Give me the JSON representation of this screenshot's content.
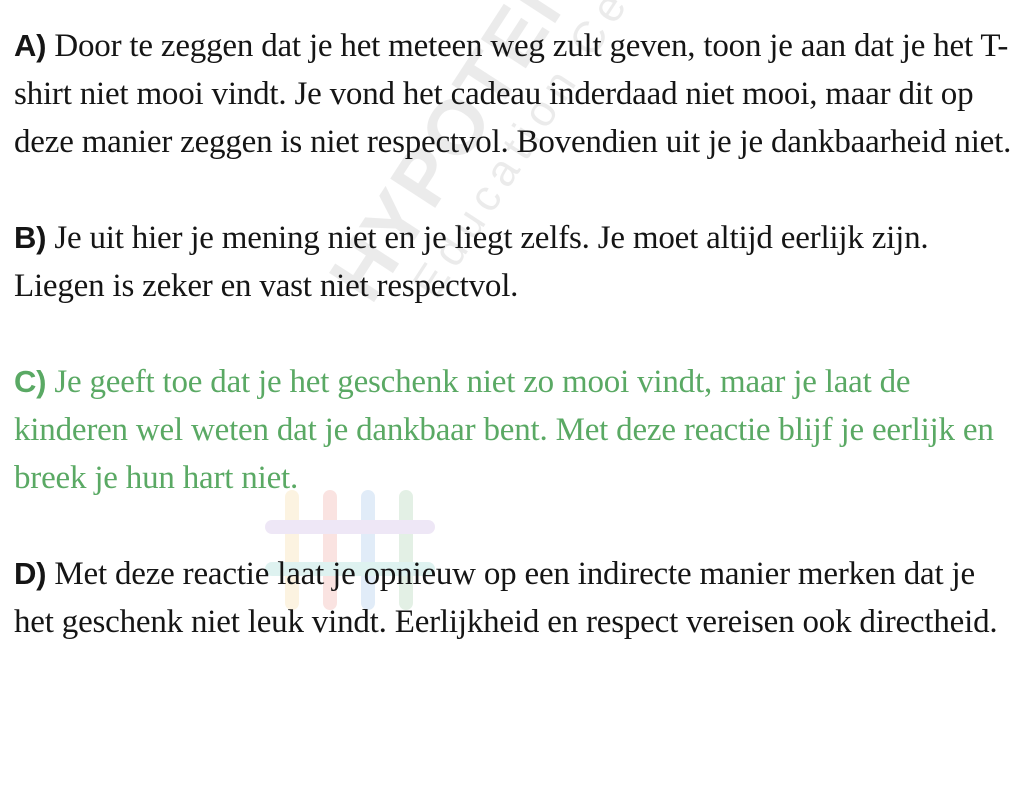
{
  "colors": {
    "text": "#151515",
    "correct": "#5aa964"
  },
  "answers": [
    {
      "letter": "A)",
      "text": " Door te zeggen dat je het meteen weg zult geven, toon je aan dat je het T-shirt niet mooi vindt. Je vond het cadeau inderdaad niet mooi, maar dit op deze manier zeggen is niet respectvol. Bovendien uit je je dankbaarheid niet."
    },
    {
      "letter": "B)",
      "text": " Je uit hier je mening niet en je liegt zelfs. Je moet altijd eerlijk zijn. Liegen is zeker en vast niet respectvol."
    },
    {
      "letter": "C)",
      "text": " Je geeft toe dat je het geschenk niet zo mooi vindt, maar je laat de kinderen wel weten dat je dankbaar bent. Met deze reactie blijf je eerlijk en breek je hun hart niet."
    },
    {
      "letter": "D)",
      "text": " Met deze reactie laat je opnieuw op een indirecte manier merken dat je het geschenk niet leuk vindt. Eerlijkheid en respect vereisen ook directheid."
    }
  ],
  "watermark": {
    "title": "HYPOTENUSE",
    "subtitle": "Education Center",
    "logo_icon": "hashtag-logo-icon"
  }
}
